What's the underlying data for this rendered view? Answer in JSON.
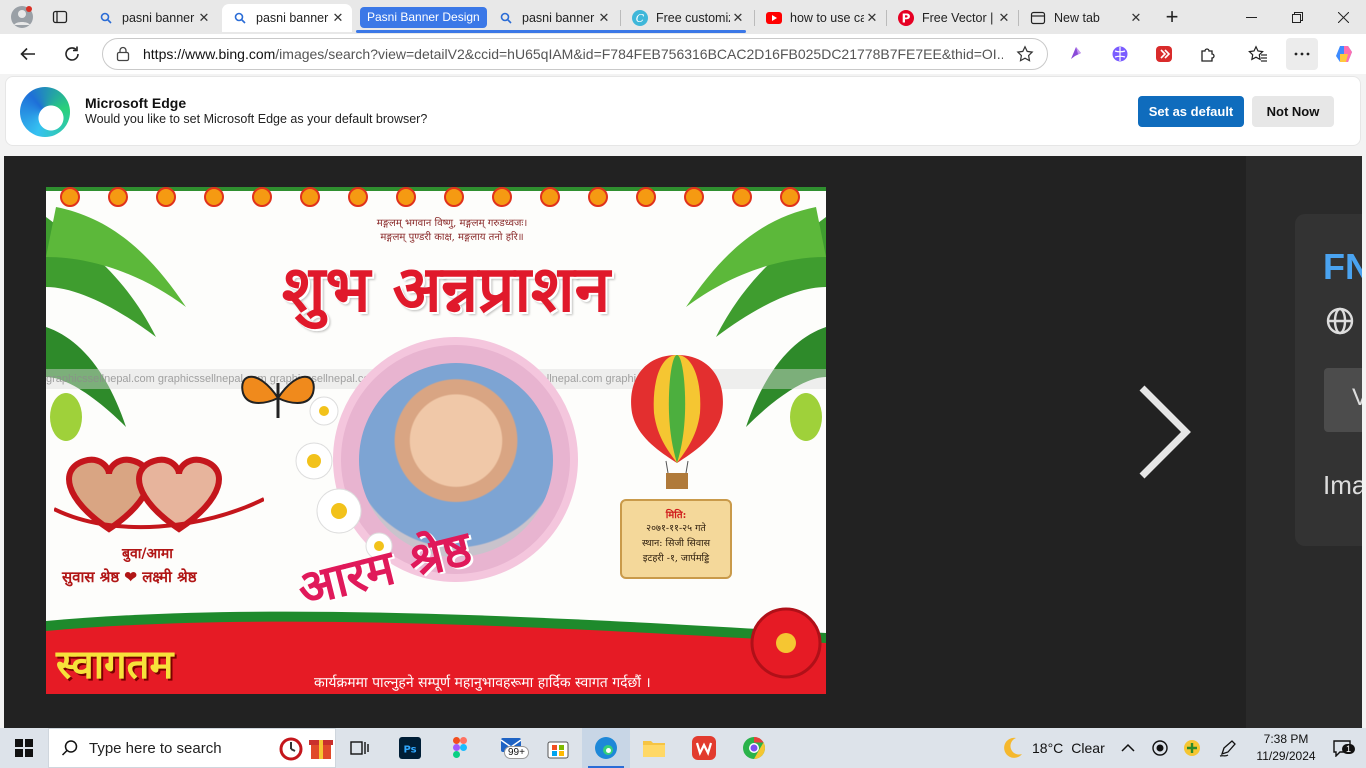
{
  "browser": {
    "tabs": [
      {
        "title": "pasni banner",
        "favicon": "bing-search-icon"
      },
      {
        "title": "pasni banner",
        "favicon": "bing-search-icon",
        "active": true
      },
      {
        "title": "pasni banner",
        "favicon": "bing-search-icon"
      },
      {
        "title": "Free customiz",
        "favicon": "canva-icon"
      },
      {
        "title": "how to use ca",
        "favicon": "youtube-icon"
      },
      {
        "title": "Free Vector | ",
        "favicon": "pinterest-icon"
      },
      {
        "title": "New tab",
        "favicon": "new-tab-icon"
      }
    ],
    "tab_group_label": "Pasni Banner Design",
    "accent": "#3b78e7"
  },
  "toolbar": {
    "url_host": "https://www.bing.com",
    "url_rest": "/images/search?view=detailV2&ccid=hU65qIAM&id=F784FEB756316BCAC2D16FB025DC21778B7FE7EE&thid=OI..."
  },
  "infobar": {
    "title": "Microsoft Edge",
    "message": "Would you like to set Microsoft Edge as your default browser?",
    "primary_button": "Set as default",
    "secondary_button": "Not Now",
    "primary_color": "#0f6cbd"
  },
  "banner": {
    "mantra_line1": "मङ्गलम् भगवान विष्णु, मङ्गलम् गरुडध्वजः।",
    "mantra_line2": "मङ्गलम् पुण्डरी काक्ष, मङ्गलाय तनो हरि॥",
    "title": "शुभ अन्नप्राशन",
    "watermark": "graphicssellnepal.com    graphicssellnepal.com    graphicssellnepal.com    graphicssellnepal.com    graphicssellnepal.com    graphicssellnepal.com",
    "child_name": "आरम श्रेष्ठ",
    "parents_label": "बुवा/आमा",
    "parents": "सुवास श्रेष्ठ ❤ लक्ष्मी श्रेष्ठ",
    "details_label": "मिति:",
    "details_date": "२०७१-११-२५ गते",
    "details_venue": "स्थान: सिजी सिवास",
    "details_place": "इटहरी -१, जार्पमड्डि",
    "welcome": "स्वागतम",
    "welcome_sub": "कार्यक्रममा पाल्नुहने सम्पूर्ण महानुभावहरूमा हार्दिक स्वागत गर्दछौं ।"
  },
  "side_panel": {
    "brand": "FN",
    "button_text": "V",
    "text": "Ima"
  },
  "taskbar": {
    "search_placeholder": "Type here to search",
    "mail_badge": "99+",
    "weather_temp": "18°C",
    "weather_condition": "Clear",
    "time": "7:38 PM",
    "date": "11/29/2024",
    "notification_count": "1"
  }
}
